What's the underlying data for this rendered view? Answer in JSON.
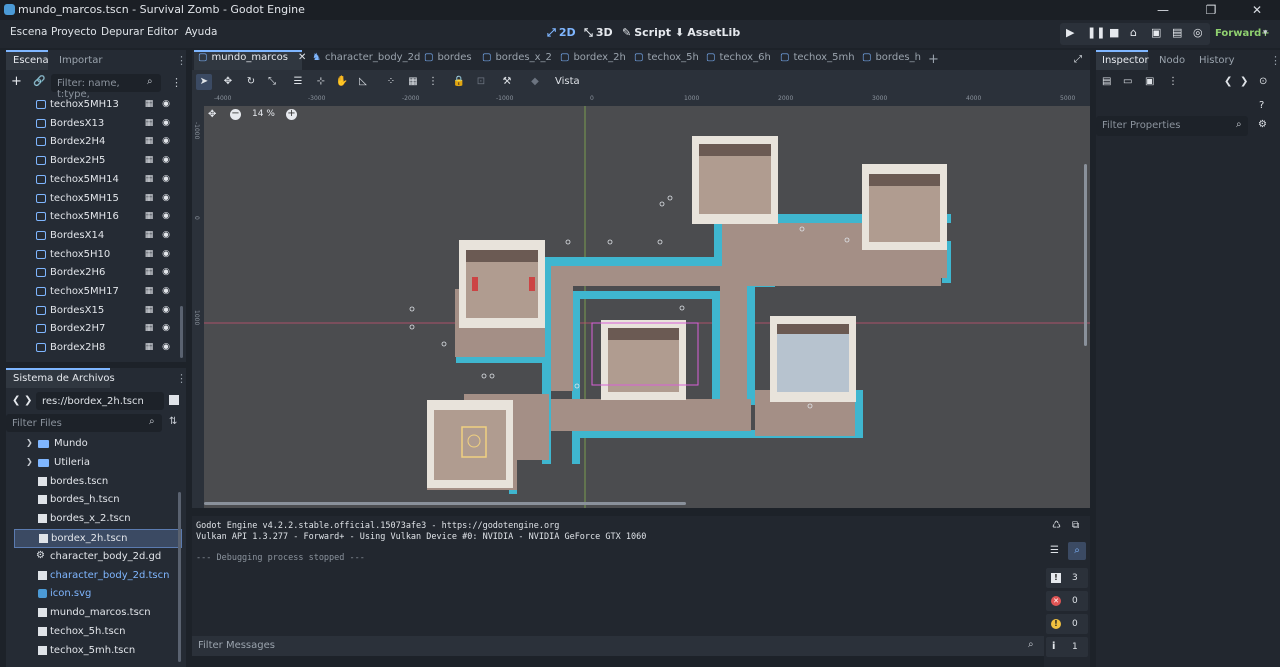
{
  "window": {
    "title": "mundo_marcos.tscn - Survival Zomb - Godot Engine",
    "controls": [
      "—",
      "❐",
      "✕"
    ]
  },
  "menu": [
    "Escena",
    "Proyecto",
    "Depurar",
    "Editor",
    "Ayuda"
  ],
  "workspaces": [
    {
      "icon": "⤢",
      "label": "2D"
    },
    {
      "icon": "⤡",
      "label": "3D"
    },
    {
      "icon": "✎",
      "label": "Script"
    },
    {
      "icon": "⬇",
      "label": "AssetLib"
    }
  ],
  "renderer": "Forward+",
  "scene_dock": {
    "tabs": [
      "Escena",
      "Importar"
    ],
    "filter_placeholder": "Filter: name, t:type,",
    "nodes": [
      "techox5MH13",
      "BordesX13",
      "Bordex2H4",
      "Bordex2H5",
      "techox5MH14",
      "techox5MH15",
      "techox5MH16",
      "BordesX14",
      "techox5H10",
      "Bordex2H6",
      "techox5MH17",
      "BordesX15",
      "Bordex2H7",
      "Bordex2H8"
    ]
  },
  "filesystem": {
    "title": "Sistema de Archivos",
    "path": "res://bordex_2h.tscn",
    "filter_placeholder": "Filter Files",
    "folders": [
      "Mundo",
      "Utileria"
    ],
    "files": [
      "bordes.tscn",
      "bordes_h.tscn",
      "bordes_x_2.tscn",
      "bordex_2h.tscn",
      "character_body_2d.gd",
      "character_body_2d.tscn",
      "icon.svg",
      "mundo_marcos.tscn",
      "techox_5h.tscn",
      "techox_5mh.tscn"
    ],
    "selected": "bordex_2h.tscn"
  },
  "scene_tabs": [
    "mundo_marcos",
    "character_body_2d",
    "bordes",
    "bordes_x_2",
    "bordex_2h",
    "techox_5h",
    "techox_6h",
    "techox_5mh",
    "bordes_h"
  ],
  "viewport": {
    "view_menu": "Vista",
    "zoom": "14 %",
    "ruler_top": [
      "-4000",
      "-3000",
      "-2000",
      "-1000",
      "0",
      "1000",
      "2000",
      "3000",
      "4000",
      "5000"
    ],
    "ruler_left": [
      "-1000",
      "0",
      "1000"
    ]
  },
  "output": {
    "lines": [
      "Godot Engine v4.2.2.stable.official.15073afe3 - https://godotengine.org",
      "Vulkan API 1.3.277 - Forward+ - Using Vulkan Device #0: NVIDIA - NVIDIA GeForce GTX 1060",
      "",
      "--- Debugging process stopped ---"
    ],
    "filter_placeholder": "Filter Messages",
    "counts": {
      "errors": "3",
      "errors_red": "0",
      "warnings": "0",
      "messages": "1"
    }
  },
  "inspector": {
    "tabs": [
      "Inspector",
      "Nodo",
      "History"
    ],
    "filter_placeholder": "Filter Properties"
  },
  "colors": {
    "accent": "#7fb6ff",
    "floor": "#a48f86",
    "wall_trim": "#3fb6cf",
    "viewport_bg": "#4b4c4f"
  }
}
